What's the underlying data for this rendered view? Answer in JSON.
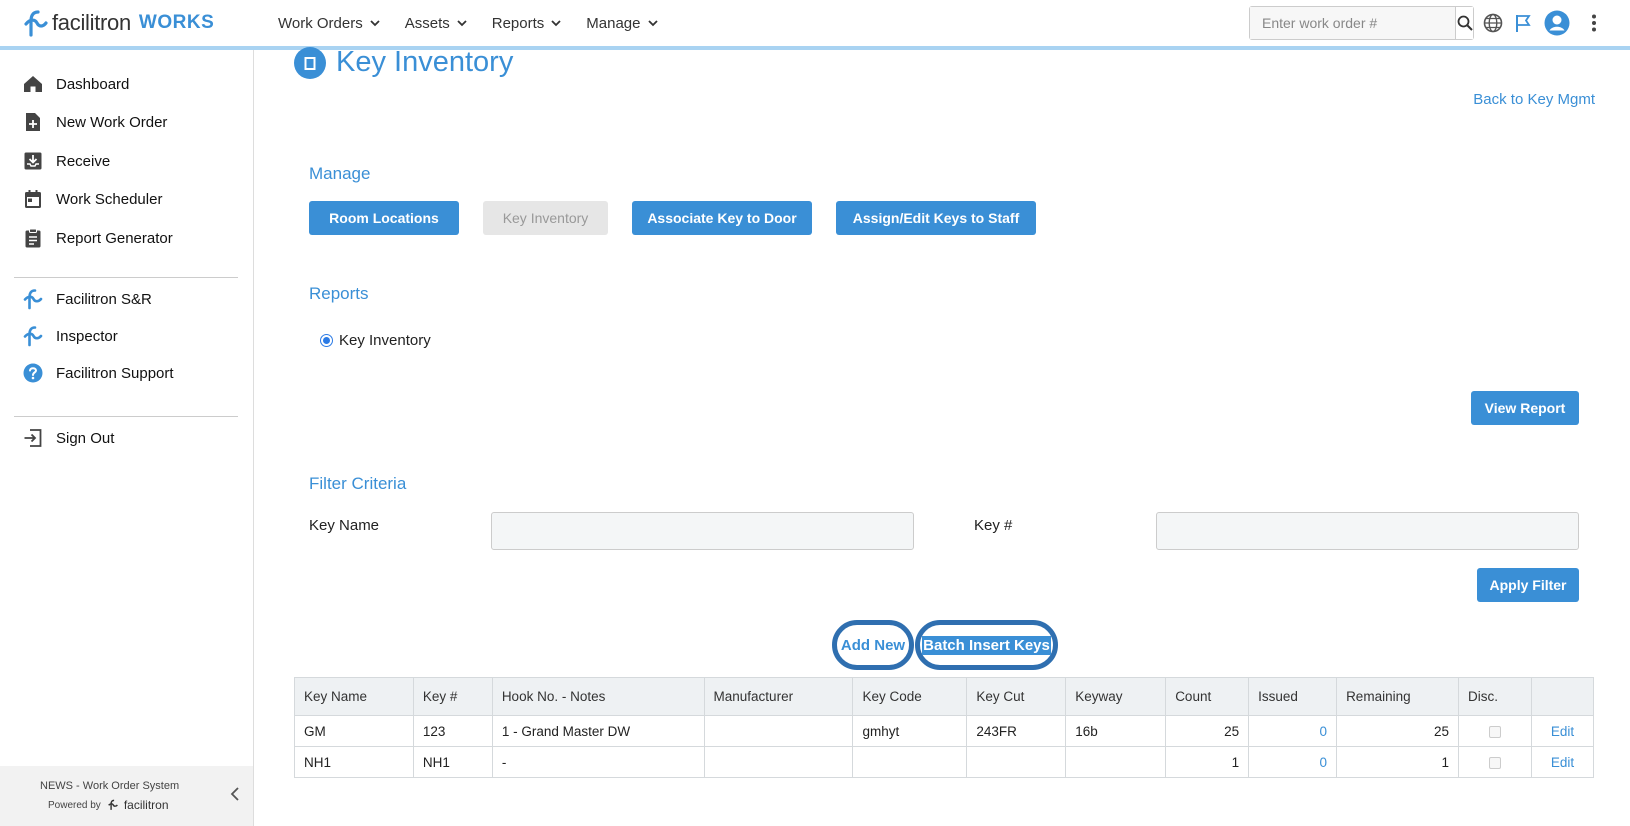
{
  "brand": {
    "name": "facilitron",
    "product": "WORKS"
  },
  "nav": {
    "items": [
      {
        "label": "Work Orders"
      },
      {
        "label": "Assets"
      },
      {
        "label": "Reports"
      },
      {
        "label": "Manage"
      }
    ]
  },
  "search": {
    "placeholder": "Enter work order #",
    "value": ""
  },
  "sidebar": {
    "items": [
      {
        "label": "Dashboard",
        "icon": "home-icon"
      },
      {
        "label": "New Work Order",
        "icon": "new-document-icon"
      },
      {
        "label": "Receive",
        "icon": "inbox-icon"
      },
      {
        "label": "Work Scheduler",
        "icon": "calendar-icon"
      },
      {
        "label": "Report Generator",
        "icon": "clipboard-icon"
      }
    ],
    "apps": [
      {
        "label": "Facilitron S&R",
        "icon": "facilitron-icon"
      },
      {
        "label": "Inspector",
        "icon": "facilitron-icon"
      },
      {
        "label": "Facilitron Support",
        "icon": "help-icon"
      }
    ],
    "sign_out": "Sign Out",
    "footer": {
      "system": "NEWS - Work Order System",
      "powered_by": "Powered by",
      "powered_brand": "facilitron"
    }
  },
  "page": {
    "title": "Key Inventory",
    "back_link": "Back to Key Mgmt",
    "manage": {
      "heading": "Manage",
      "buttons": {
        "room_locations": "Room Locations",
        "key_inventory": "Key Inventory",
        "associate": "Associate Key to Door",
        "assign": "Assign/Edit Keys to Staff"
      }
    },
    "reports": {
      "heading": "Reports",
      "option": "Key Inventory",
      "view_button": "View Report"
    },
    "filter": {
      "heading": "Filter Criteria",
      "key_name_label": "Key Name",
      "key_num_label": "Key #",
      "key_name_value": "",
      "key_num_value": "",
      "apply_button": "Apply Filter"
    },
    "actions": {
      "add_new": "Add New",
      "batch_insert": "Batch Insert Keys"
    },
    "table": {
      "headers": {
        "key_name": "Key Name",
        "key_num": "Key #",
        "hook_notes": "Hook No. - Notes",
        "manufacturer": "Manufacturer",
        "key_code": "Key Code",
        "key_cut": "Key Cut",
        "keyway": "Keyway",
        "count": "Count",
        "issued": "Issued",
        "remaining": "Remaining",
        "disc": "Disc."
      },
      "edit_label": "Edit",
      "rows": [
        {
          "key_name": "GM",
          "key_num": "123",
          "hook_notes": "1 - Grand Master DW",
          "manufacturer": "",
          "key_code": "gmhyt",
          "key_cut": "243FR",
          "keyway": "16b",
          "count": "25",
          "issued": "0",
          "remaining": "25"
        },
        {
          "key_name": "NH1",
          "key_num": "NH1",
          "hook_notes": "-",
          "manufacturer": "",
          "key_code": "",
          "key_cut": "",
          "keyway": "",
          "count": "1",
          "issued": "0",
          "remaining": "1"
        }
      ]
    }
  },
  "colors": {
    "accent": "#3a8fd6",
    "highlight_ring": "#2f6fb0",
    "disabled": "#e6e6e6"
  }
}
